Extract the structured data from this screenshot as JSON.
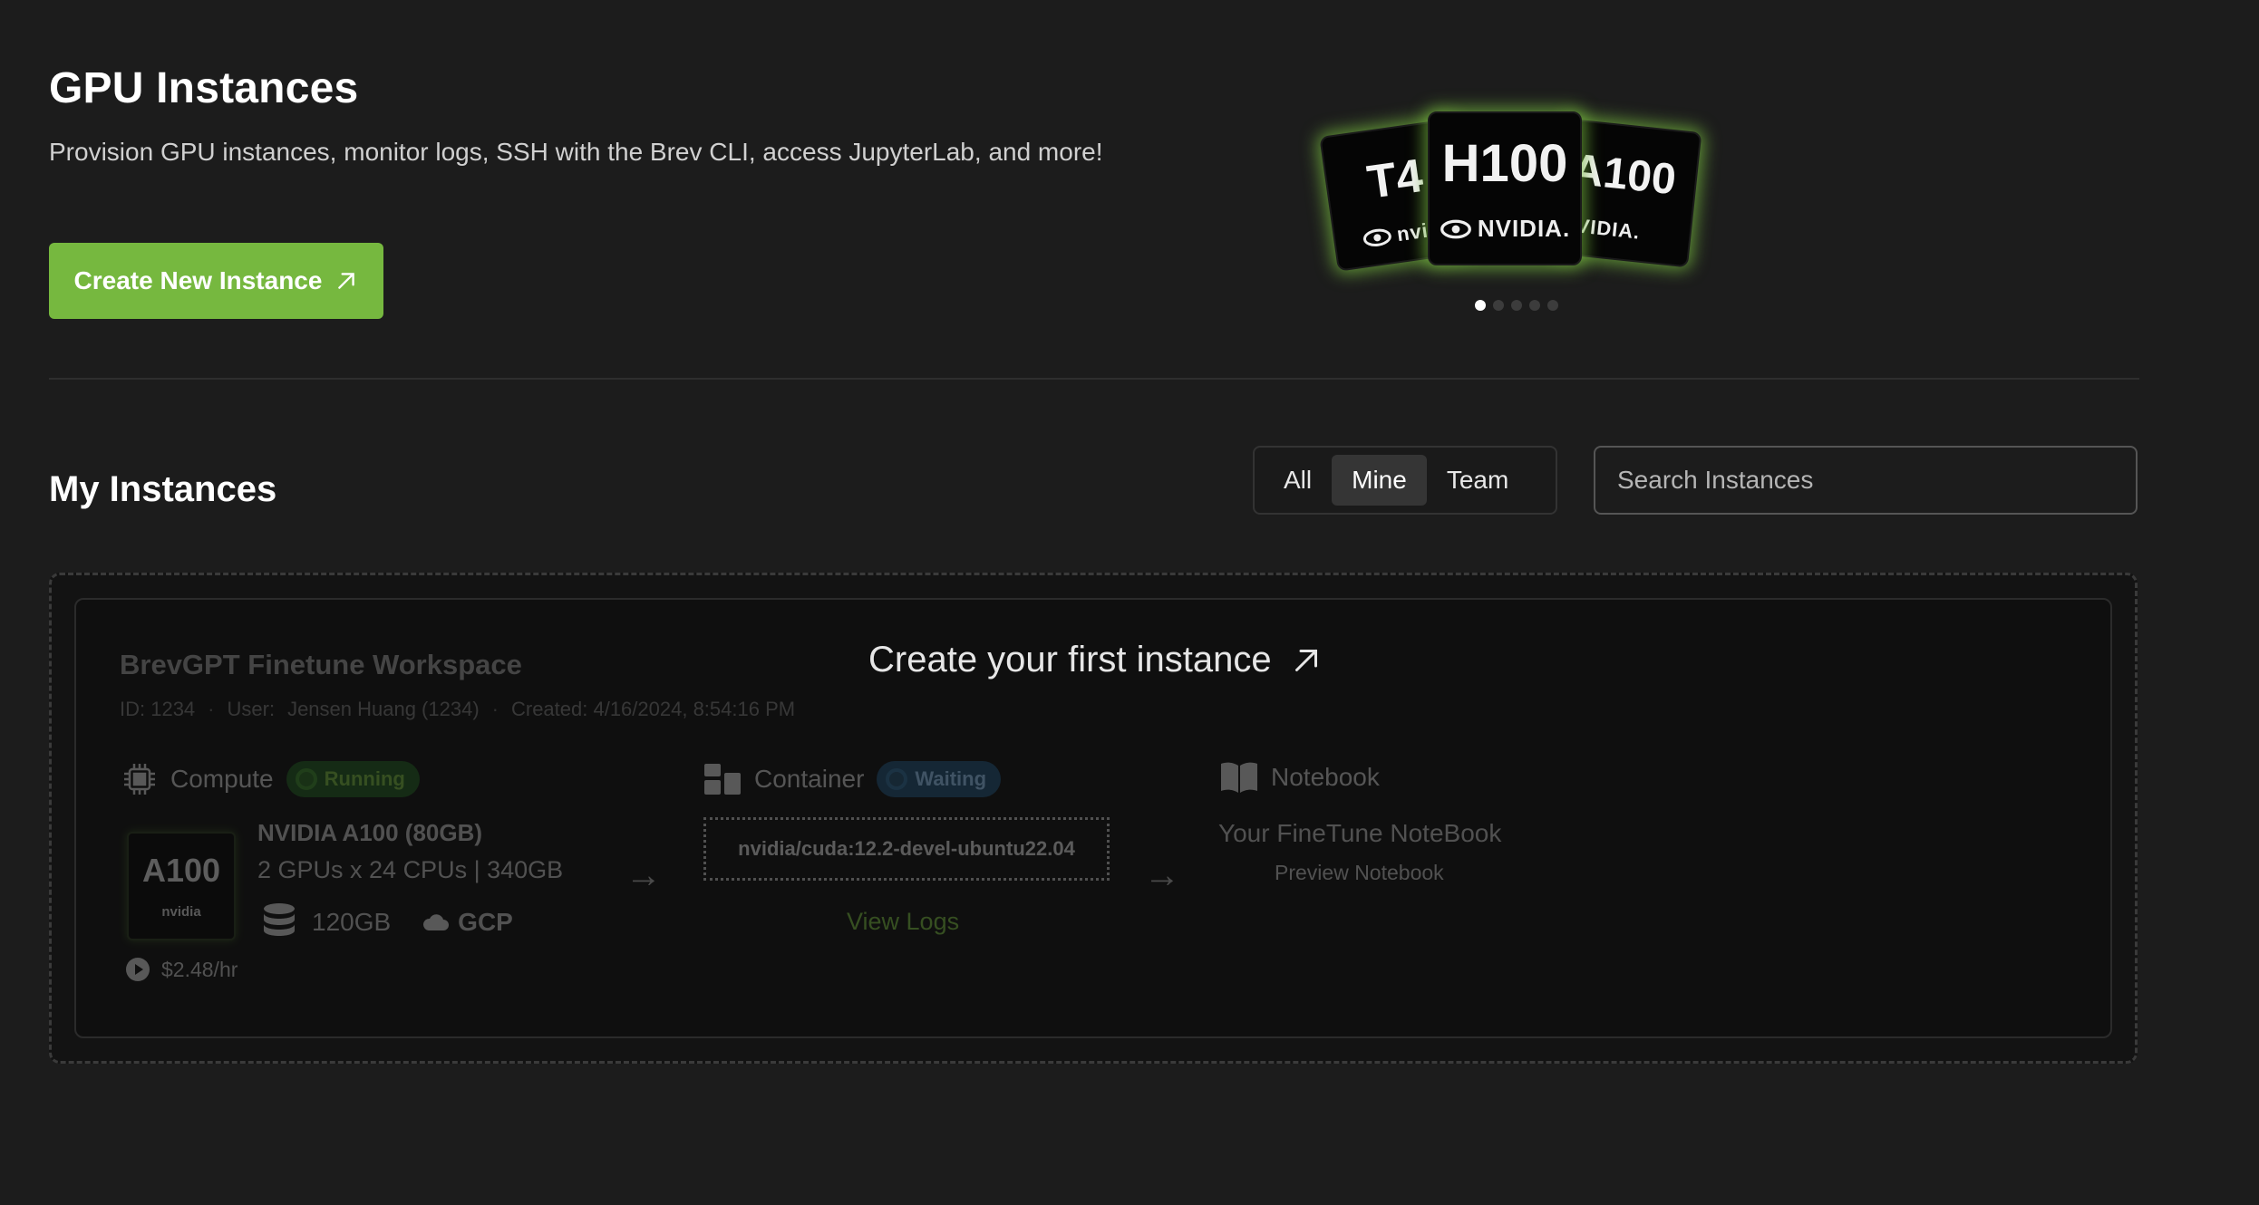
{
  "header": {
    "title": "GPU Instances",
    "description": "Provision GPU instances, monitor logs, SSH with the Brev CLI, access JupyterLab, and more!",
    "create_button": "Create New Instance"
  },
  "carousel": {
    "cards": [
      {
        "model": "T4",
        "brand": "nvidia"
      },
      {
        "model": "H100",
        "brand": "NVIDIA."
      },
      {
        "model": "A100",
        "brand": "NVIDIA."
      }
    ],
    "active_index": 0,
    "total": 5,
    "glow_color": "#76b83f"
  },
  "instances": {
    "title": "My Instances",
    "filters": [
      "All",
      "Mine",
      "Team"
    ],
    "active_filter": "Mine",
    "search_placeholder": "Search Instances"
  },
  "empty_state": {
    "cta": "Create your first instance",
    "preview": {
      "workspace_name": "BrevGPT Finetune Workspace",
      "id": "ID: 1234",
      "user_label": "User:",
      "user": "Jensen Huang (1234)",
      "created": "Created: 4/16/2024, 8:54:16 PM",
      "compute": {
        "label": "Compute",
        "status": "Running",
        "card_model": "A100",
        "card_brand": "nvidia",
        "gpu_name": "NVIDIA A100 (80GB)",
        "gpu_spec": "2 GPUs x 24 CPUs | 340GB",
        "storage": "120GB",
        "cloud": "GCP",
        "price": "$2.48/hr"
      },
      "container": {
        "label": "Container",
        "status": "Waiting",
        "image": "nvidia/cuda:12.2-devel-ubuntu22.04",
        "logs_link": "View Logs"
      },
      "notebook": {
        "label": "Notebook",
        "title": "Your FineTune NoteBook",
        "link": "Preview Notebook"
      }
    }
  },
  "colors": {
    "accent": "#76b83f",
    "background": "#1c1c1c",
    "running": "#1f5a1f",
    "waiting": "#1f4f73"
  }
}
